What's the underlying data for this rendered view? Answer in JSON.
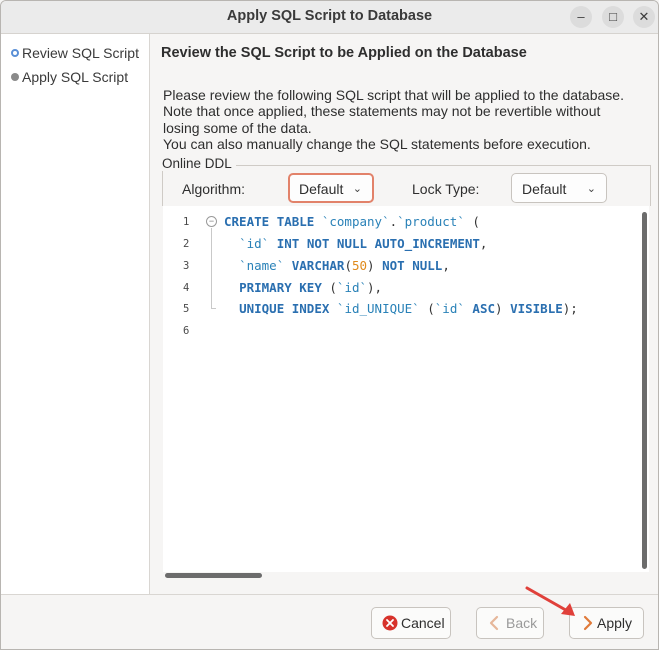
{
  "window": {
    "title": "Apply SQL Script to Database"
  },
  "titlebar_buttons": [
    "minimize-icon",
    "maximize-icon",
    "close-icon"
  ],
  "sidebar": {
    "steps": [
      {
        "label": "Review SQL Script",
        "state": "active"
      },
      {
        "label": "Apply SQL Script",
        "state": "pending"
      }
    ]
  },
  "main": {
    "heading": "Review the SQL Script to be Applied on the Database",
    "description": [
      "Please review the following SQL script that will be applied to the database.",
      "Note that once applied, these statements may not be revertible without",
      "losing some of the data.",
      "You can also manually change the SQL statements before execution."
    ],
    "online_ddl": {
      "legend": "Online DDL",
      "algorithm_label": "Algorithm:",
      "algorithm_value": "Default",
      "lock_type_label": "Lock Type:",
      "lock_type_value": "Default"
    },
    "editor": {
      "line_numbers": [
        "1",
        "2",
        "3",
        "4",
        "5",
        "6"
      ],
      "lines": [
        "CREATE TABLE `company`.`product` (",
        "  `id` INT NOT NULL AUTO_INCREMENT,",
        "  `name` VARCHAR(50) NOT NULL,",
        "  PRIMARY KEY (`id`),",
        "  UNIQUE INDEX `id_UNIQUE` (`id` ASC) VISIBLE);",
        ""
      ]
    }
  },
  "footer": {
    "cancel_label": "Cancel",
    "back_label": "Back",
    "apply_label": "Apply"
  },
  "colors": {
    "keyword": "#2a6fb0",
    "identifier": "#2a82b8",
    "number": "#e08a1a",
    "focus_border": "#e2826a",
    "cancel_icon": "#d7322b",
    "annotation_arrow": "#e0403a"
  }
}
